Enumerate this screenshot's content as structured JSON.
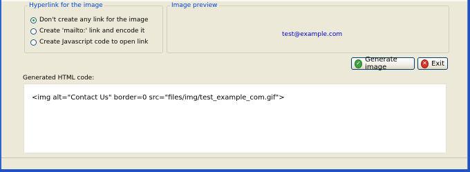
{
  "hyperlink_group": {
    "legend": "Hyperlink for the image",
    "options": [
      {
        "label": "Don't create any link for the image",
        "checked": true
      },
      {
        "label": "Create 'mailto:' link and encode it",
        "checked": false
      },
      {
        "label": "Create Javascript code to open link",
        "checked": false
      }
    ]
  },
  "preview_group": {
    "legend": "Image preview",
    "preview_text": "test@example.com"
  },
  "buttons": {
    "generate": "Generate image",
    "exit": "Exit"
  },
  "code": {
    "label": "Generated HTML code:",
    "value": "<img alt=\"Contact Us\" border=0 src=\"files/img/test_example_com.gif\">"
  },
  "colors": {
    "legend_text": "#0046d5",
    "preview_text": "#0000cc",
    "window_frame": "#1f52c2"
  }
}
